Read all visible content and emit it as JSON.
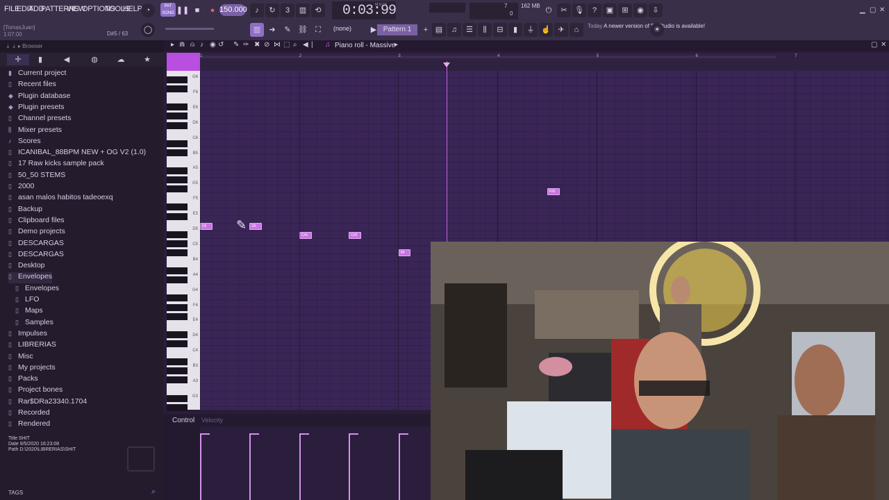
{
  "menu": [
    "FILE",
    "EDIT",
    "ADD",
    "PATTERNS",
    "VIEW",
    "OPTIONS",
    "TOOLS",
    "HELP"
  ],
  "hint": {
    "user": "[TomasJuan]",
    "position": "1:07:00",
    "note_info": "D#5 / 63"
  },
  "transport": {
    "mode_label": "PAT SONG",
    "tempo": "150.000",
    "time": "0:03:99",
    "time_unit": "M:S:CS",
    "memory": "162 MB",
    "cpu_value": "7",
    "cpu_zero": "0"
  },
  "pattern": {
    "name": "Pattern 1",
    "channel": "(none)"
  },
  "news": {
    "date": "Today",
    "text": "A newer version of FL Studio is available!"
  },
  "browser": {
    "header": "Browser",
    "items": [
      {
        "label": "Current project",
        "icon": "project-icon"
      },
      {
        "label": "Recent files",
        "icon": "folder-icon"
      },
      {
        "label": "Plugin database",
        "icon": "plugin-icon"
      },
      {
        "label": "Plugin presets",
        "icon": "plugin-icon"
      },
      {
        "label": "Channel presets",
        "icon": "folder-icon"
      },
      {
        "label": "Mixer presets",
        "icon": "mixer-icon"
      },
      {
        "label": "Scores",
        "icon": "note-icon"
      },
      {
        "label": "ICANIBAL_88BPM NEW + OG V2 (1.0)",
        "icon": "folder-icon"
      },
      {
        "label": "17 Raw kicks sample pack",
        "icon": "folder-icon"
      },
      {
        "label": "50_50 STEMS",
        "icon": "folder-icon"
      },
      {
        "label": "2000",
        "icon": "folder-icon"
      },
      {
        "label": "asan malos habitos tadeoexq",
        "icon": "folder-icon"
      },
      {
        "label": "Backup",
        "icon": "folder-icon"
      },
      {
        "label": "Clipboard files",
        "icon": "folder-icon"
      },
      {
        "label": "Demo projects",
        "icon": "folder-icon"
      },
      {
        "label": "DESCARGAS",
        "icon": "folder-icon"
      },
      {
        "label": "DESCARGAS",
        "icon": "folder-icon"
      },
      {
        "label": "Desktop",
        "icon": "folder-icon"
      },
      {
        "label": "Envelopes",
        "icon": "folder-icon"
      },
      {
        "label": "Envelopes",
        "icon": "folder-icon"
      },
      {
        "label": "LFO",
        "icon": "folder-icon"
      },
      {
        "label": "Maps",
        "icon": "folder-icon"
      },
      {
        "label": "Samples",
        "icon": "folder-icon"
      },
      {
        "label": "Impulses",
        "icon": "folder-icon"
      },
      {
        "label": "LIBRERIAS",
        "icon": "folder-icon"
      },
      {
        "label": "Misc",
        "icon": "folder-icon"
      },
      {
        "label": "My projects",
        "icon": "folder-icon"
      },
      {
        "label": "Packs",
        "icon": "folder-icon"
      },
      {
        "label": "Project bones",
        "icon": "folder-icon"
      },
      {
        "label": "Rar$DRa23340.1704",
        "icon": "folder-icon"
      },
      {
        "label": "Recorded",
        "icon": "folder-icon"
      },
      {
        "label": "Rendered",
        "icon": "folder-icon"
      }
    ],
    "info": {
      "title_key": "Title",
      "title": "SHIT",
      "date_key": "Date",
      "date": "9/5/2020 16:23:08",
      "path_key": "Path",
      "path": "D:\\2020\\LIBRERIAS\\SHIT"
    },
    "tags": "TAGS"
  },
  "piano_roll": {
    "title": "Piano roll - Massive",
    "bars": [
      "1",
      "2",
      "3",
      "4",
      "5",
      "6",
      "7"
    ],
    "octaves": [
      "G6",
      "F6",
      "E6",
      "D6",
      "C6",
      "B5",
      "A5",
      "G5",
      "F5",
      "E5",
      "D5",
      "C5",
      "B4",
      "A4",
      "G4",
      "F4",
      "E4",
      "D4",
      "C4",
      "B3",
      "A3",
      "G3"
    ],
    "notes": [
      {
        "label": "D5",
        "start_beat": 0.0,
        "length_beats": 0.5,
        "pitch": "D5"
      },
      {
        "label": "D5",
        "start_beat": 2.0,
        "length_beats": 0.5,
        "pitch": "D5"
      },
      {
        "label": "C#5",
        "start_beat": 4.0,
        "length_beats": 0.5,
        "pitch": "C#5"
      },
      {
        "label": "C#5",
        "start_beat": 6.0,
        "length_beats": 0.5,
        "pitch": "C#5"
      },
      {
        "label": "B4",
        "start_beat": 8.0,
        "length_beats": 0.5,
        "pitch": "B4"
      },
      {
        "label": "F#5",
        "start_beat": 14.0,
        "length_beats": 0.5,
        "pitch": "F#5"
      }
    ],
    "control_label": "Control",
    "control_sub": "Velocity"
  },
  "colors": {
    "accent": "#c874e3",
    "bg": "#3a2557",
    "topbar": "#3a2f48"
  }
}
